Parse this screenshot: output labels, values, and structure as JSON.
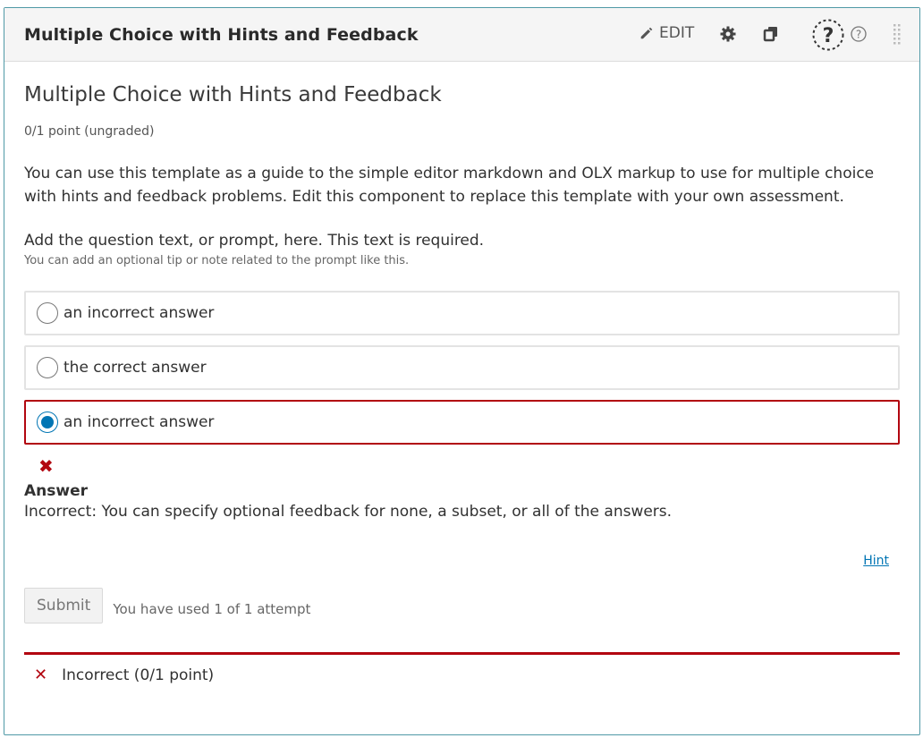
{
  "header": {
    "title": "Multiple Choice with Hints and Feedback",
    "edit_label": "EDIT"
  },
  "problem": {
    "title": "Multiple Choice with Hints and Feedback",
    "points": "0/1 point (ungraded)",
    "intro": "You can use this template as a guide to the simple editor markdown and OLX markup to use for multiple choice with hints and feedback problems. Edit this component to replace this template with your own assessment.",
    "prompt": "Add the question text, or prompt, here. This text is required.",
    "tip": "You can add an optional tip or note related to the prompt like this."
  },
  "choices": [
    {
      "label": "an incorrect answer",
      "selected": false
    },
    {
      "label": "the correct answer",
      "selected": false
    },
    {
      "label": "an incorrect answer",
      "selected": true
    }
  ],
  "feedback": {
    "heading": "Answer",
    "text": "Incorrect:  You can specify optional feedback for none, a subset, or all of the answers."
  },
  "hint_label": "Hint",
  "submit": {
    "label": "Submit",
    "attempts": "You have used 1 of 1 attempt"
  },
  "status": {
    "text": "Incorrect (0/1 point)"
  },
  "colors": {
    "incorrect": "#b20610",
    "accent": "#0075b4",
    "frame": "#4f99a6"
  }
}
